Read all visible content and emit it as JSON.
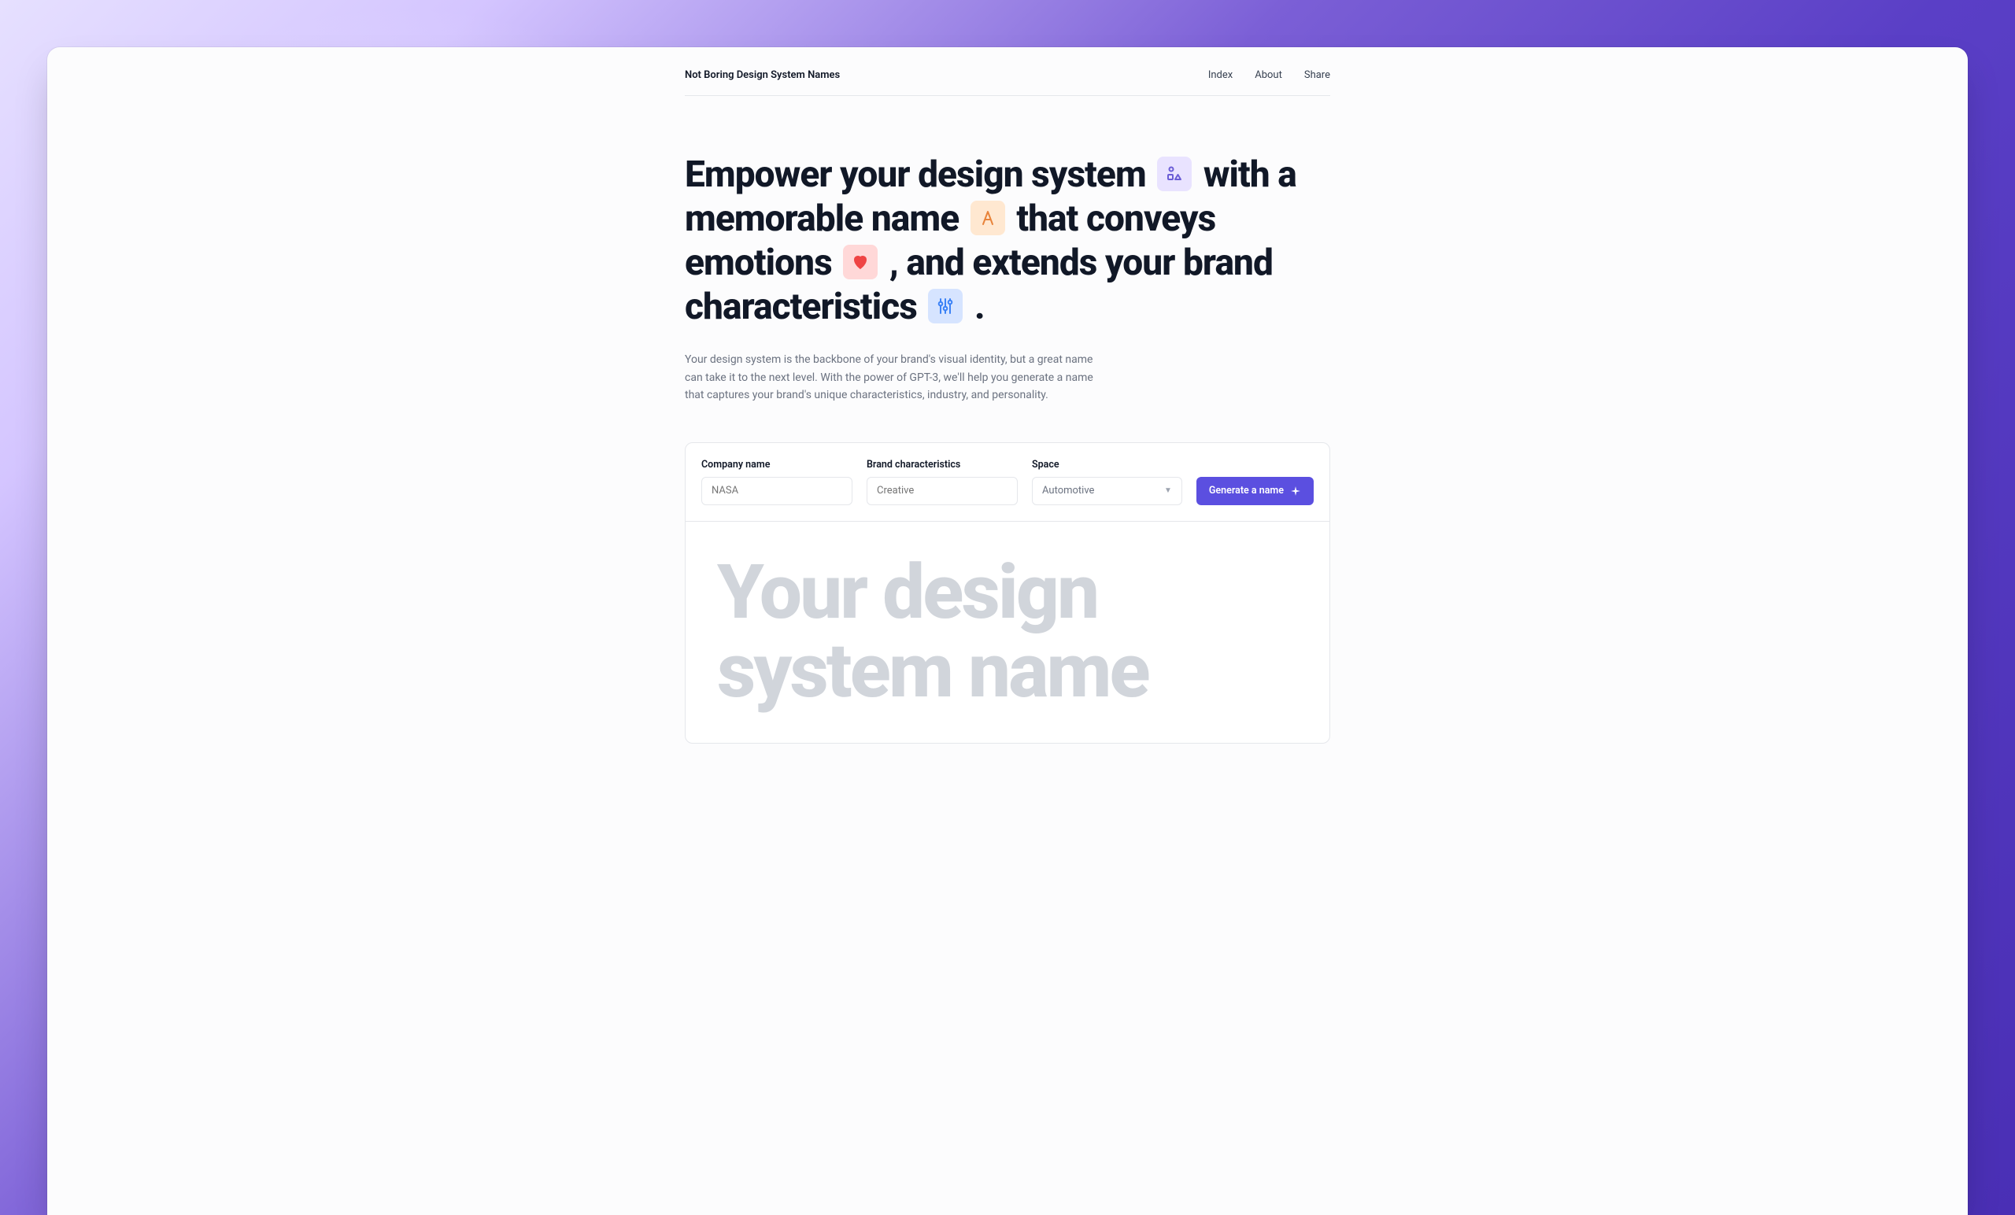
{
  "header": {
    "brand": "Not Boring Design System Names",
    "nav": [
      {
        "label": "Index"
      },
      {
        "label": "About"
      },
      {
        "label": "Share"
      }
    ]
  },
  "hero": {
    "t1": "Empower your design system ",
    "t2": " with a memorable name ",
    "t3": " that conveys emotions ",
    "t4": " , and extends your brand characteristics ",
    "t5": " ."
  },
  "subtitle": "Your design system is the backbone of your brand's visual identity, but a great name can take it to the next level. With the power of GPT-3, we'll help you generate a name that captures your brand's unique characteristics, industry, and personality.",
  "form": {
    "company": {
      "label": "Company name",
      "placeholder": "NASA"
    },
    "characteristics": {
      "label": "Brand characteristics",
      "placeholder": "Creative"
    },
    "space": {
      "label": "Space",
      "value": "Automotive"
    },
    "button": "Generate a name"
  },
  "result": {
    "placeholder": "Your design system name"
  }
}
